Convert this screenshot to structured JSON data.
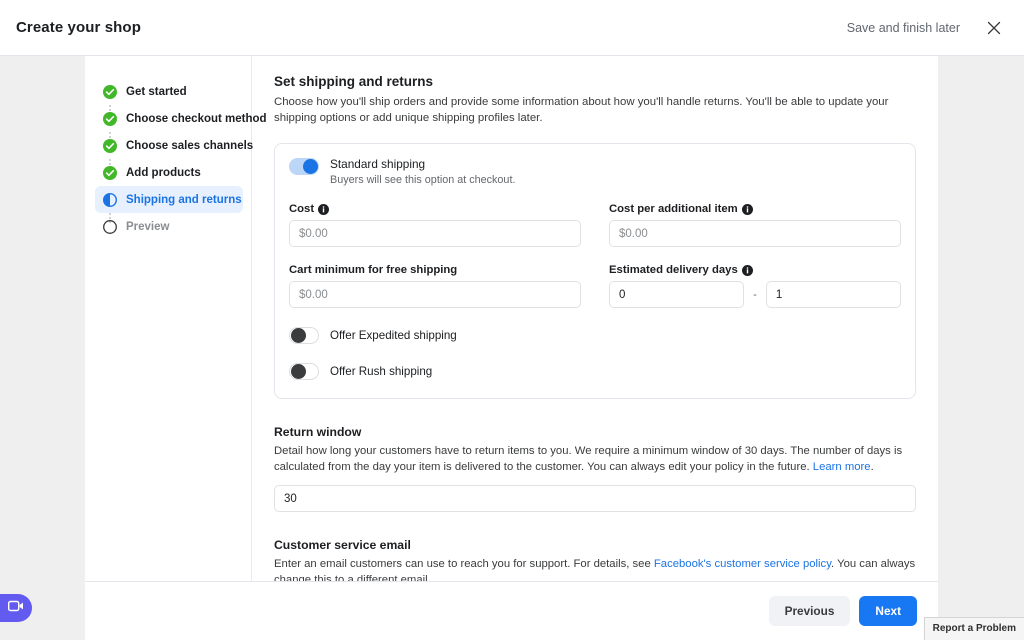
{
  "topbar": {
    "title": "Create your shop",
    "save_later": "Save and finish later",
    "close_icon": "close-icon"
  },
  "stepper": {
    "items": [
      {
        "label": "Get started",
        "state": "complete",
        "icon": "check-circle-icon"
      },
      {
        "label": "Choose checkout method",
        "state": "complete",
        "icon": "check-circle-icon"
      },
      {
        "label": "Choose sales channels",
        "state": "complete",
        "icon": "check-circle-icon"
      },
      {
        "label": "Add products",
        "state": "complete",
        "icon": "check-circle-icon"
      },
      {
        "label": "Shipping and returns",
        "state": "active",
        "icon": "half-circle-icon"
      },
      {
        "label": "Preview",
        "state": "pending",
        "icon": "empty-circle-icon"
      }
    ]
  },
  "main": {
    "heading": "Set shipping and returns",
    "description": "Choose how you'll ship orders and provide some information about how you'll handle returns. You'll be able to update your shipping options or add unique shipping profiles later.",
    "shipping_card": {
      "standard": {
        "title": "Standard shipping",
        "subtitle": "Buyers will see this option at checkout.",
        "enabled": "on"
      },
      "cost": {
        "label": "Cost",
        "placeholder": "$0.00",
        "value": "",
        "info_icon": "info-icon"
      },
      "cost_additional": {
        "label": "Cost per additional item",
        "placeholder": "$0.00",
        "value": "",
        "info_icon": "info-icon"
      },
      "cart_minimum": {
        "label": "Cart minimum for free shipping",
        "placeholder": "$0.00",
        "value": ""
      },
      "delivery_days": {
        "label": "Estimated delivery days",
        "info_icon": "info-icon",
        "min_value": "0",
        "max_value": "1",
        "separator": "-"
      },
      "expedited": {
        "label": "Offer Expedited shipping",
        "enabled": "off"
      },
      "rush": {
        "label": "Offer Rush shipping",
        "enabled": "off"
      }
    },
    "return_window": {
      "heading": "Return window",
      "description_before": "Detail how long your customers have to return items to you. We require a minimum window of 30 days. The number of days is calculated from the day your item is delivered to the customer. You can always edit your policy in the future. ",
      "link": "Learn more",
      "description_after": ".",
      "value": "30"
    },
    "customer_service_email": {
      "heading": "Customer service email",
      "description_before": "Enter an email customers can use to reach you for support. For details, see ",
      "link": "Facebook's customer service policy",
      "description_after": ". You can always change this to a different email.",
      "value": "",
      "placeholder": ""
    }
  },
  "footer": {
    "previous": "Previous",
    "next": "Next"
  },
  "floating": {
    "recorder_icon": "video-camera-icon",
    "report_problem": "Report a Problem"
  },
  "colors": {
    "accent_blue": "#1877f2",
    "link_blue": "#1b74e4",
    "active_bg": "#e7f0fe",
    "complete_green": "#42b72a",
    "recorder_purple": "#635bf0"
  }
}
